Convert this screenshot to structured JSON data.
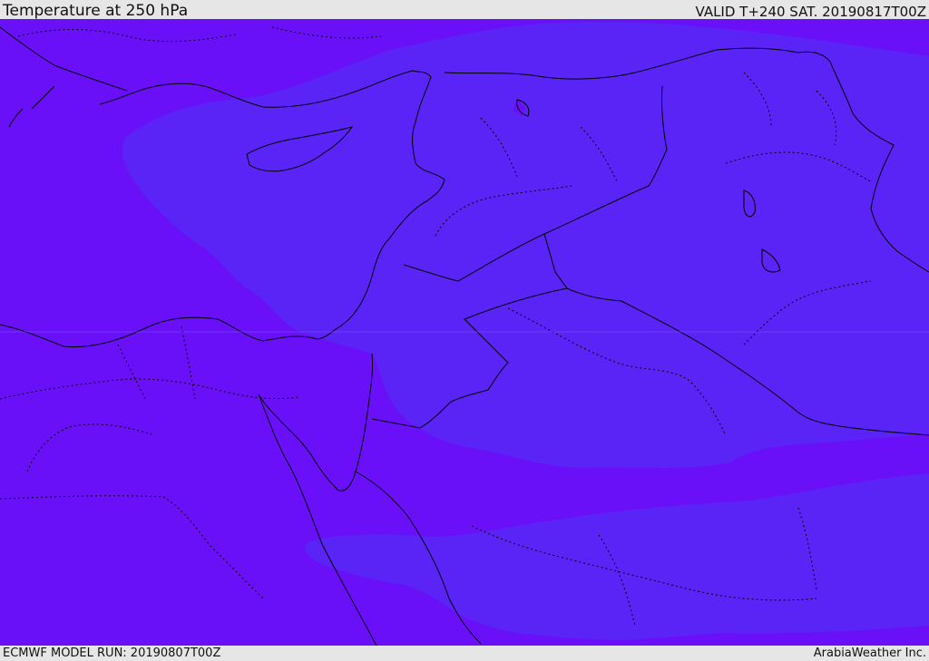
{
  "header": {
    "title": "Temperature at 250 hPa",
    "valid": "VALID T+240 SAT. 20190817T00Z"
  },
  "footer": {
    "model_run": "ECMWF MODEL RUN: 20190807T00Z",
    "credit": "ArabiaWeather Inc."
  },
  "colors": {
    "background_field": "#6a10f9",
    "contour_band": "#5a24f6",
    "borders": "#000000"
  }
}
